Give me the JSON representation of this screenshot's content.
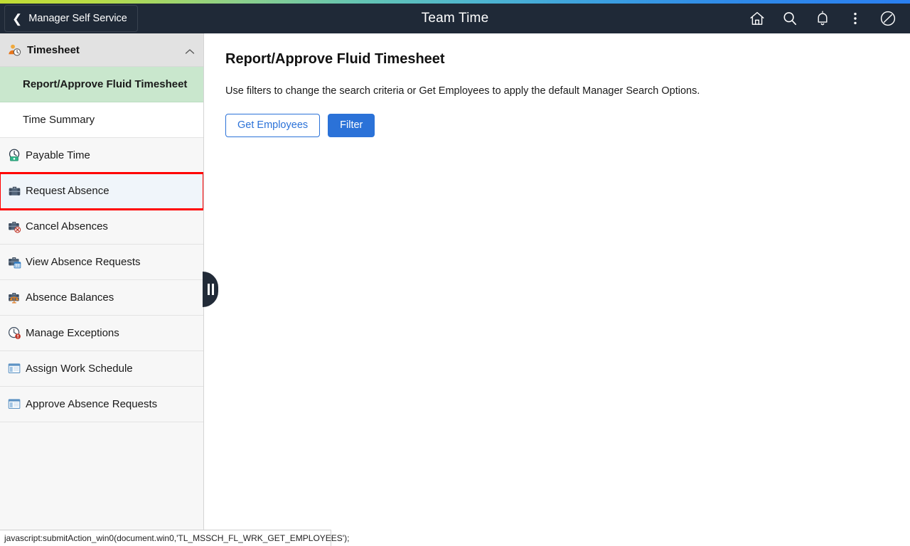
{
  "header": {
    "back_label": "Manager Self Service",
    "back_icon": "chevron-left-icon",
    "title": "Team Time",
    "icons": [
      {
        "name": "home-icon",
        "label": "Home"
      },
      {
        "name": "search-icon",
        "label": "Search"
      },
      {
        "name": "notification-bell-icon",
        "label": "Notifications"
      },
      {
        "name": "actions-menu-icon",
        "label": "Actions"
      },
      {
        "name": "navbar-compass-icon",
        "label": "NavBar"
      }
    ],
    "accent_gradient_from": "#c3dd34",
    "accent_gradient_to": "#2a7ff0",
    "background": "#1f2937"
  },
  "sidebar": {
    "group": {
      "label": "Timesheet",
      "icon": "person-clock-icon",
      "expanded": true,
      "caret_icon": "chevron-up-icon"
    },
    "sub_items": [
      {
        "label": "Report/Approve Fluid Timesheet",
        "selected": true
      },
      {
        "label": "Time Summary",
        "selected": false
      }
    ],
    "items": [
      {
        "label": "Payable Time",
        "icon": "clock-money-icon",
        "state": "normal"
      },
      {
        "label": "Request Absence",
        "icon": "briefcase-icon",
        "state": "hovered-highlighted"
      },
      {
        "label": "Cancel Absences",
        "icon": "briefcase-cancel-icon",
        "state": "normal"
      },
      {
        "label": "View Absence Requests",
        "icon": "briefcase-calendar-icon",
        "state": "normal"
      },
      {
        "label": "Absence Balances",
        "icon": "briefcase-balance-icon",
        "state": "normal"
      },
      {
        "label": "Manage Exceptions",
        "icon": "clock-alert-icon",
        "state": "normal"
      },
      {
        "label": "Assign Work Schedule",
        "icon": "window-page-icon",
        "state": "normal"
      },
      {
        "label": "Approve Absence Requests",
        "icon": "window-page-icon",
        "state": "normal"
      }
    ],
    "collapse_handle": {
      "name": "sidebar-collapse-handle",
      "icon": "pause-bars-icon"
    },
    "selected_background": "#c9e7cd",
    "hover_background": "#f0f5fa",
    "highlight_color": "#ff0000"
  },
  "main": {
    "page_title": "Report/Approve Fluid Timesheet",
    "instructions": "Use filters to change the search criteria or Get Employees to apply the default Manager Search Options.",
    "buttons": [
      {
        "label": "Get Employees",
        "style": "secondary"
      },
      {
        "label": "Filter",
        "style": "primary"
      }
    ],
    "primary_color": "#2b72d8"
  },
  "statusbar": {
    "text": "javascript:submitAction_win0(document.win0,'TL_MSSCH_FL_WRK_GET_EMPLOYEES');"
  }
}
